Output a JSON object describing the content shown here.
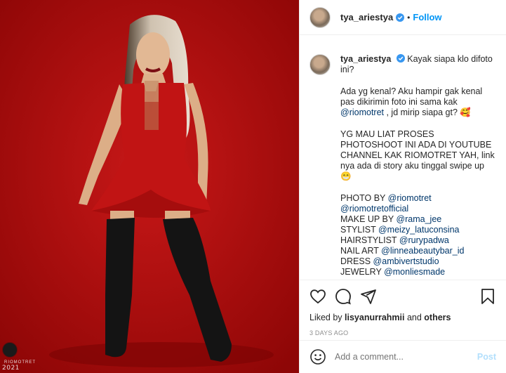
{
  "post": {
    "username": "tya_ariestya",
    "follow_label": "Follow",
    "dot": "•",
    "watermark_year": "2021",
    "watermark_text": "RIOMOTRET",
    "caption": {
      "username": "tya_ariestya",
      "intro": "Kayak siapa klo difoto ini?",
      "p2_text": "Ada yg kenal? Aku hampir gak kenal pas dikirimin foto ini sama kak ",
      "p2_mention": "@riomotret",
      "p2_tail": " , jd mirip siapa gt? 🥰",
      "p3": "YG MAU LIAT PROSES PHOTOSHOOT INI ADA DI YOUTUBE CHANNEL KAK RIOMOTRET YAH, link nya ada di story aku tinggal swipe up 😁",
      "credits": [
        {
          "label": "PHOTO BY ",
          "mention": "@riomotret"
        },
        {
          "label": "",
          "mention": "@riomotretofficial"
        },
        {
          "label": "MAKE UP BY ",
          "mention": "@rama_jee"
        },
        {
          "label": "STYLIST ",
          "mention": "@meizy_latuconsina"
        },
        {
          "label": "HAIRSTYLIST ",
          "mention": "@rurypadwa"
        },
        {
          "label": "NAIL ART ",
          "mention": "@linneabeautybar_id"
        },
        {
          "label": "DRESS ",
          "mention": "@ambivertstudio"
        },
        {
          "label": "JEWELRY ",
          "mention": "@monliesmade"
        }
      ]
    },
    "likes": {
      "prefix": "Liked by ",
      "user": "lisyanurrahmii",
      "middle": " and ",
      "others": "others"
    },
    "timestamp": "3 DAYS AGO",
    "comment_placeholder": "Add a comment...",
    "post_label": "Post",
    "icons": {
      "like": "heart-icon",
      "comment": "comment-icon",
      "share": "share-icon",
      "save": "bookmark-icon",
      "emoji": "emoji-icon",
      "verified": "verified-badge-icon"
    },
    "colors": {
      "accent": "#0095f6",
      "mention": "#00376b",
      "photo_bg": "#b10d0d"
    }
  }
}
